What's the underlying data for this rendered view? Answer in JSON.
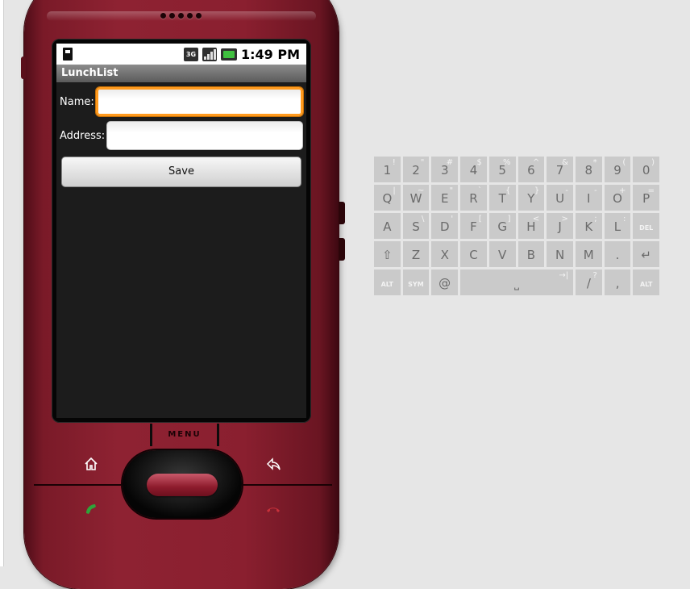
{
  "status_bar": {
    "time": "1:49 PM",
    "network": "3G"
  },
  "app": {
    "title": "LunchList"
  },
  "form": {
    "name_label": "Name:",
    "name_value": "",
    "address_label": "Address:",
    "address_value": "",
    "save_label": "Save"
  },
  "hardware": {
    "menu_label": "MENU"
  },
  "keyboard": {
    "rows": [
      [
        {
          "main": "1",
          "alt": "!"
        },
        {
          "main": "2",
          "alt": "\""
        },
        {
          "main": "3",
          "alt": "#"
        },
        {
          "main": "4",
          "alt": "$"
        },
        {
          "main": "5",
          "alt": "%"
        },
        {
          "main": "6",
          "alt": "^"
        },
        {
          "main": "7",
          "alt": "&"
        },
        {
          "main": "8",
          "alt": "*"
        },
        {
          "main": "9",
          "alt": "("
        },
        {
          "main": "0",
          "alt": ")"
        }
      ],
      [
        {
          "main": "Q",
          "alt": "|"
        },
        {
          "main": "W",
          "alt": "~"
        },
        {
          "main": "E",
          "alt": "\""
        },
        {
          "main": "R",
          "alt": "`"
        },
        {
          "main": "T",
          "alt": "{"
        },
        {
          "main": "Y",
          "alt": "}"
        },
        {
          "main": "U",
          "alt": "-"
        },
        {
          "main": "I",
          "alt": "-"
        },
        {
          "main": "O",
          "alt": "+"
        },
        {
          "main": "P",
          "alt": "="
        }
      ],
      [
        {
          "main": "A",
          "alt": ""
        },
        {
          "main": "S",
          "alt": "\\"
        },
        {
          "main": "D",
          "alt": "'"
        },
        {
          "main": "F",
          "alt": "["
        },
        {
          "main": "G",
          "alt": "]"
        },
        {
          "main": "H",
          "alt": "<"
        },
        {
          "main": "J",
          "alt": ">"
        },
        {
          "main": "K",
          "alt": ";"
        },
        {
          "main": "L",
          "alt": ":"
        },
        {
          "main": "",
          "alt": "",
          "small": "DEL",
          "icon": "del"
        }
      ],
      [
        {
          "main": "⇧",
          "alt": "",
          "icon": "shift"
        },
        {
          "main": "Z",
          "alt": ""
        },
        {
          "main": "X",
          "alt": ""
        },
        {
          "main": "C",
          "alt": ""
        },
        {
          "main": "V",
          "alt": ""
        },
        {
          "main": "B",
          "alt": ""
        },
        {
          "main": "N",
          "alt": ""
        },
        {
          "main": "M",
          "alt": ""
        },
        {
          "main": ".",
          "alt": ""
        },
        {
          "main": "↵",
          "alt": "",
          "icon": "enter"
        }
      ],
      [
        {
          "main": "",
          "alt": "",
          "small": "ALT"
        },
        {
          "main": "",
          "alt": "",
          "small": "SYM"
        },
        {
          "main": "@",
          "alt": ""
        },
        {
          "main": "⎵",
          "alt": "→|",
          "space": true
        },
        {
          "main": "/",
          "alt": "?"
        },
        {
          "main": ",",
          "alt": ""
        },
        {
          "main": "",
          "alt": "",
          "small": "ALT"
        }
      ]
    ]
  },
  "colors": {
    "phone_body": "#8a1f2f",
    "focus_ring": "#ff9a1e",
    "page_bg": "#e6e6e6",
    "call_green": "#2fa33a",
    "end_red": "#c8303a"
  }
}
